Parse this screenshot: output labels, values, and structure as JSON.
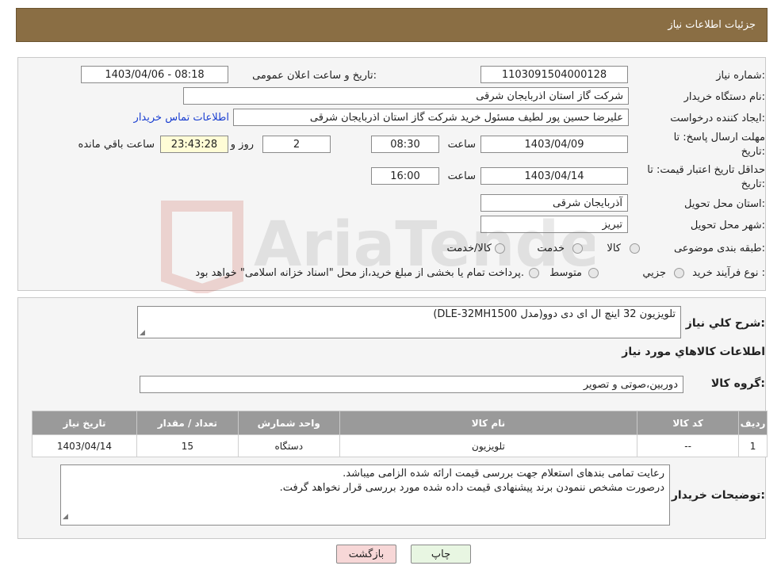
{
  "header": {
    "title": "جزئیات اطلاعات نیاز"
  },
  "form": {
    "need_number_label": "شماره نیاز:",
    "need_number": "1103091504000128",
    "announce_label": "تاریخ و ساعت اعلان عمومی:",
    "announce_value": "1403/04/06 - 08:18",
    "buyer_org_label": "نام دستگاه خریدار:",
    "buyer_org": "شرکت گاز استان اذربایجان شرقی",
    "creator_label": "ایجاد کننده درخواست:",
    "creator": "علیرضا حسین پور لطیف مسئول خرید  شرکت گاز استان اذربایجان شرقی",
    "contact_link": "اطلاعات تماس خریدار",
    "deadline_label_1": "مهلت ارسال پاسخ: تا",
    "deadline_label_2": "تاریخ:",
    "deadline_date": "1403/04/09",
    "time_label": "ساعت",
    "deadline_time": "08:30",
    "days_value": "2",
    "days_label": "روز و",
    "remaining_time": "23:43:28",
    "remaining_label": "ساعت باقي مانده",
    "validity_label_1": "حداقل تاریخ اعتبار قیمت: تا",
    "validity_label_2": "تاریخ:",
    "validity_date": "1403/04/14",
    "validity_time": "16:00",
    "province_label": "استان محل تحویل:",
    "province": "آذربایجان شرقی",
    "city_label": "شهر محل تحویل:",
    "city": "تبریز",
    "category_label": "طبقه بندی موضوعی:",
    "category_options": [
      "کالا",
      "خدمت",
      "کالا/خدمت"
    ],
    "process_label": "نوع فرآیند خرید :",
    "process_options": [
      "جزیي",
      "متوسط"
    ],
    "process_note": "پرداخت تمام یا بخشی از مبلغ خرید،از محل \"اسناد خزانه اسلامی\" خواهد بود."
  },
  "details": {
    "summary_label": "شرح كلي نياز:",
    "summary": "تلویزیون 32 اینچ  ال ای دی دوو(مدل DLE-32MH1500)",
    "items_title": "اطلاعات كالاهاي مورد نياز",
    "group_label": "گروه كالا:",
    "group": "دوربین،صوتی و تصویر",
    "table": {
      "headers": [
        "ردیف",
        "کد کالا",
        "نام کالا",
        "واحد شمارش",
        "تعداد / مقدار",
        "تاریخ نیاز"
      ],
      "rows": [
        [
          "1",
          "--",
          "تلویزیون",
          "دستگاه",
          "15",
          "1403/04/14"
        ]
      ]
    },
    "buyer_notes_label": "توضیحات خریدار:",
    "buyer_notes_1": "رعایت تمامی بندهای استعلام جهت بررسی قیمت ارائه شده الزامی میباشد.",
    "buyer_notes_2": "درصورت مشخص ننمودن برند پیشنهادی قیمت داده شده مورد بررسی قرار نخواهد گرفت."
  },
  "buttons": {
    "print": "چاپ",
    "back": "بازگشت"
  },
  "watermark": {
    "text": "AriaTender.neT"
  },
  "colors": {
    "header_bg": "#8a6e44",
    "link": "#1a3fd1",
    "back_btn": "#f7d7d7",
    "print_btn": "#e8f6e2"
  }
}
